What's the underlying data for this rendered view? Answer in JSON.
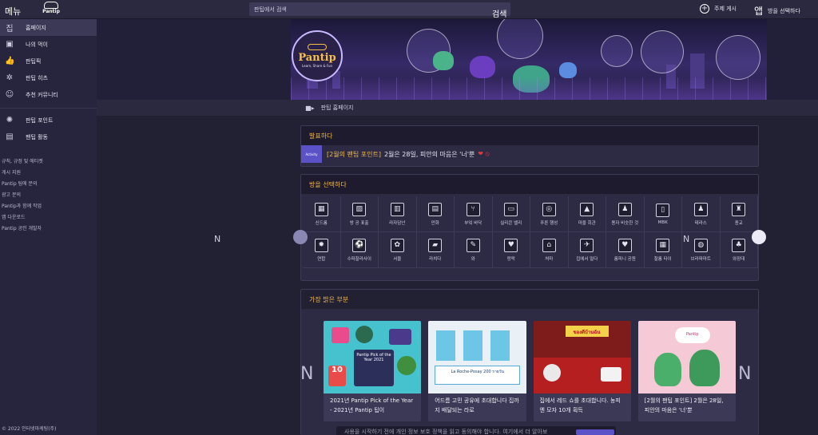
{
  "topbar": {
    "menu_label": "메뉴",
    "logo_text": "Pantip",
    "search_placeholder": "판팁에서 검색",
    "search_icon_label": "검색",
    "new_topic_label": "주제 게시",
    "choose_room_label": "방을 선택하다",
    "app_label": "앱"
  },
  "sidebar": {
    "items": [
      {
        "icon": "home-icon",
        "glyph": "집",
        "label": "홈페이지",
        "active": true
      },
      {
        "icon": "feed-icon",
        "glyph": "▣",
        "label": "나의 먹이"
      },
      {
        "icon": "thumbs-up-icon",
        "glyph": "👍",
        "label": "판팁픽"
      },
      {
        "icon": "trending-icon",
        "glyph": "✲",
        "label": "판팁 히츠"
      },
      {
        "icon": "smile-icon",
        "glyph": "☺",
        "label": "추천 커뮤니티"
      },
      {
        "icon": "points-icon",
        "glyph": "✺",
        "label": "판팁 포인트"
      },
      {
        "icon": "calendar-icon",
        "glyph": "▤",
        "label": "팬팁 활동"
      }
    ],
    "links": [
      "규칙, 규정 및 에티켓",
      "게시 지원",
      "Pantip 팀에 문의",
      "광고 문의",
      "Pantip과 함께 작업",
      "앱 다운로드",
      "Pantip 공인 개발자"
    ],
    "copyright": "© 2022 인터넷마케팅(주)"
  },
  "banner": {
    "logo_brand": "Pantip",
    "logo_tagline": "Learn, Share & Fun"
  },
  "breadcrumb": {
    "label": "판팁 홈페이지"
  },
  "announcement": {
    "title": "발표하다",
    "ribbon": "Activity",
    "link_text": "[2월의 팬팁 포인트]",
    "text": "2월은 28일, 피안의 마음은 '너'뿐"
  },
  "rooms": {
    "title": "방을 선택하다",
    "items": [
      {
        "icon": "sindrome-icon",
        "glyph": "▦",
        "label": "신드롬"
      },
      {
        "icon": "gallery-icon",
        "glyph": "▨",
        "label": "방 공 표출"
      },
      {
        "icon": "city-icon",
        "glyph": "▥",
        "label": "라자담넌"
      },
      {
        "icon": "book-icon",
        "glyph": "▤",
        "label": "만화"
      },
      {
        "icon": "utensils-icon",
        "glyph": "⑂",
        "label": "부엌 바닥"
      },
      {
        "icon": "computer-icon",
        "glyph": "▭",
        "label": "실리콘 밸리"
      },
      {
        "icon": "camera-icon",
        "glyph": "◎",
        "label": "푸른 행성"
      },
      {
        "icon": "tent-icon",
        "glyph": "▲",
        "label": "마을 회관"
      },
      {
        "icon": "people-icon",
        "glyph": "♟",
        "label": "용자 비슷한 것"
      },
      {
        "icon": "phone-icon",
        "glyph": "▯",
        "label": "MBK"
      },
      {
        "icon": "restroom-icon",
        "glyph": "♟",
        "label": "테라스"
      },
      {
        "icon": "religion-icon",
        "glyph": "♜",
        "label": "종교"
      },
      {
        "icon": "gear-icon",
        "glyph": "✹",
        "label": "연합"
      },
      {
        "icon": "sports-icon",
        "glyph": "⚽",
        "label": "수파찰라사이"
      },
      {
        "icon": "palette-icon",
        "glyph": "✿",
        "label": "서울"
      },
      {
        "icon": "car-icon",
        "glyph": "▰",
        "label": "라치다"
      },
      {
        "icon": "microphone-icon",
        "glyph": "✎",
        "label": "와"
      },
      {
        "icon": "heart-hand-icon",
        "glyph": "♥",
        "label": "랑락"
      },
      {
        "icon": "house-icon",
        "glyph": "⌂",
        "label": "처마"
      },
      {
        "icon": "plane-icon",
        "glyph": "✈",
        "label": "집에서 멀다"
      },
      {
        "icon": "heart-gear-icon",
        "glyph": "♥",
        "label": "룸피니 공원"
      },
      {
        "icon": "film-icon",
        "glyph": "▦",
        "label": "찰롬 타이"
      },
      {
        "icon": "globe-icon",
        "glyph": "◍",
        "label": "브라파마트"
      },
      {
        "icon": "drinks-icon",
        "glyph": "♣",
        "label": "와장대"
      }
    ]
  },
  "highlights": {
    "title": "가장 밝은 부분",
    "cards": [
      {
        "title": "2021년 Pantip Pick of the Year - 2021년 Pantip 팁이",
        "img_text": "Pantip Pick of the Year 2021"
      },
      {
        "title": "어드름 고민 공유에 초대합니다 집까지 배달되는 라로",
        "img_text": "La Roche-Posay 200 รายวัน"
      },
      {
        "title": "집에서 레드 쇼를 초대합니다. 농피엔 모자 10개 획득",
        "img_text": "ของดีบ้านฉัน"
      },
      {
        "title": "[2월의 팬팁 포인트] 2월은 28일, 피안의 마음은 '너'뿐",
        "img_text": "Pantip"
      }
    ]
  },
  "nav_letters": {
    "rooms_left": "N",
    "rooms_right": "N",
    "cards_left": "N",
    "cards_right": "N"
  },
  "cookie": {
    "text": "사용을 시작하기 전에 개인 정보 보호 정책을 읽고 동의해야 합니다. 여기에서 더 알아보"
  }
}
